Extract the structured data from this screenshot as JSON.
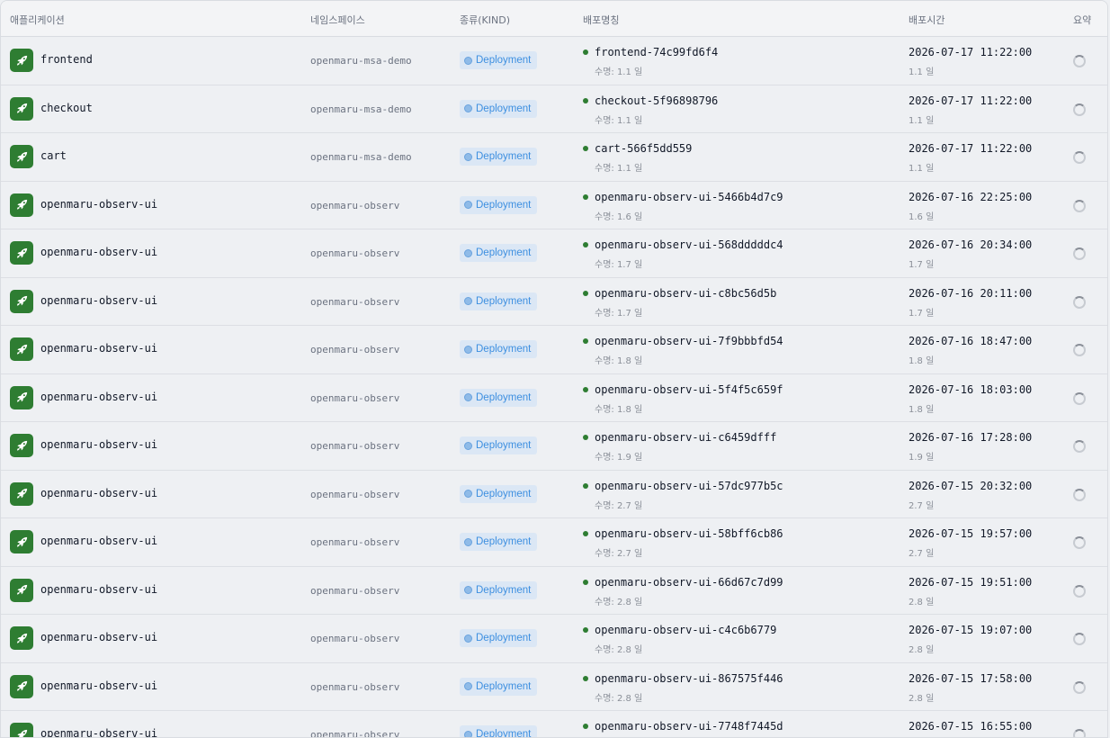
{
  "table": {
    "headers": {
      "app": "애플리케이션",
      "namespace": "네임스페이스",
      "kind": "종류(KIND)",
      "deploy_name": "배포명칭",
      "deploy_time": "배포시간",
      "summary": "요약"
    },
    "rows": [
      {
        "app": "frontend",
        "namespace": "openmaru-msa-demo",
        "kind": "Deployment",
        "deploy_name": "frontend-74c99fd6f4",
        "life": "수명: 1.1 일",
        "time": "2026-07-17 11:22:00",
        "ago": "1.1 일"
      },
      {
        "app": "checkout",
        "namespace": "openmaru-msa-demo",
        "kind": "Deployment",
        "deploy_name": "checkout-5f96898796",
        "life": "수명: 1.1 일",
        "time": "2026-07-17 11:22:00",
        "ago": "1.1 일"
      },
      {
        "app": "cart",
        "namespace": "openmaru-msa-demo",
        "kind": "Deployment",
        "deploy_name": "cart-566f5dd559",
        "life": "수명: 1.1 일",
        "time": "2026-07-17 11:22:00",
        "ago": "1.1 일"
      },
      {
        "app": "openmaru-observ-ui",
        "namespace": "openmaru-observ",
        "kind": "Deployment",
        "deploy_name": "openmaru-observ-ui-5466b4d7c9",
        "life": "수명: 1.6 일",
        "time": "2026-07-16 22:25:00",
        "ago": "1.6 일"
      },
      {
        "app": "openmaru-observ-ui",
        "namespace": "openmaru-observ",
        "kind": "Deployment",
        "deploy_name": "openmaru-observ-ui-568dddddc4",
        "life": "수명: 1.7 일",
        "time": "2026-07-16 20:34:00",
        "ago": "1.7 일"
      },
      {
        "app": "openmaru-observ-ui",
        "namespace": "openmaru-observ",
        "kind": "Deployment",
        "deploy_name": "openmaru-observ-ui-c8bc56d5b",
        "life": "수명: 1.7 일",
        "time": "2026-07-16 20:11:00",
        "ago": "1.7 일"
      },
      {
        "app": "openmaru-observ-ui",
        "namespace": "openmaru-observ",
        "kind": "Deployment",
        "deploy_name": "openmaru-observ-ui-7f9bbbfd54",
        "life": "수명: 1.8 일",
        "time": "2026-07-16 18:47:00",
        "ago": "1.8 일"
      },
      {
        "app": "openmaru-observ-ui",
        "namespace": "openmaru-observ",
        "kind": "Deployment",
        "deploy_name": "openmaru-observ-ui-5f4f5c659f",
        "life": "수명: 1.8 일",
        "time": "2026-07-16 18:03:00",
        "ago": "1.8 일"
      },
      {
        "app": "openmaru-observ-ui",
        "namespace": "openmaru-observ",
        "kind": "Deployment",
        "deploy_name": "openmaru-observ-ui-c6459dfff",
        "life": "수명: 1.9 일",
        "time": "2026-07-16 17:28:00",
        "ago": "1.9 일"
      },
      {
        "app": "openmaru-observ-ui",
        "namespace": "openmaru-observ",
        "kind": "Deployment",
        "deploy_name": "openmaru-observ-ui-57dc977b5c",
        "life": "수명: 2.7 일",
        "time": "2026-07-15 20:32:00",
        "ago": "2.7 일"
      },
      {
        "app": "openmaru-observ-ui",
        "namespace": "openmaru-observ",
        "kind": "Deployment",
        "deploy_name": "openmaru-observ-ui-58bff6cb86",
        "life": "수명: 2.7 일",
        "time": "2026-07-15 19:57:00",
        "ago": "2.7 일"
      },
      {
        "app": "openmaru-observ-ui",
        "namespace": "openmaru-observ",
        "kind": "Deployment",
        "deploy_name": "openmaru-observ-ui-66d67c7d99",
        "life": "수명: 2.8 일",
        "time": "2026-07-15 19:51:00",
        "ago": "2.8 일"
      },
      {
        "app": "openmaru-observ-ui",
        "namespace": "openmaru-observ",
        "kind": "Deployment",
        "deploy_name": "openmaru-observ-ui-c4c6b6779",
        "life": "수명: 2.8 일",
        "time": "2026-07-15 19:07:00",
        "ago": "2.8 일"
      },
      {
        "app": "openmaru-observ-ui",
        "namespace": "openmaru-observ",
        "kind": "Deployment",
        "deploy_name": "openmaru-observ-ui-867575f446",
        "life": "수명: 2.8 일",
        "time": "2026-07-15 17:58:00",
        "ago": "2.8 일"
      },
      {
        "app": "openmaru-observ-ui",
        "namespace": "openmaru-observ",
        "kind": "Deployment",
        "deploy_name": "openmaru-observ-ui-7748f7445d",
        "life": "",
        "time": "2026-07-15 16:55:00",
        "ago": ""
      }
    ]
  },
  "icons": {
    "app": "rocket-icon",
    "kind": "deployment-icon",
    "status": "status-dot",
    "summary": "loading-spinner-icon"
  },
  "colors": {
    "app_icon_bg": "#2e7d32",
    "status_ok": "#2e7d32",
    "kind_badge_bg": "#dbe7f5",
    "kind_badge_text": "#3d8fe0"
  }
}
